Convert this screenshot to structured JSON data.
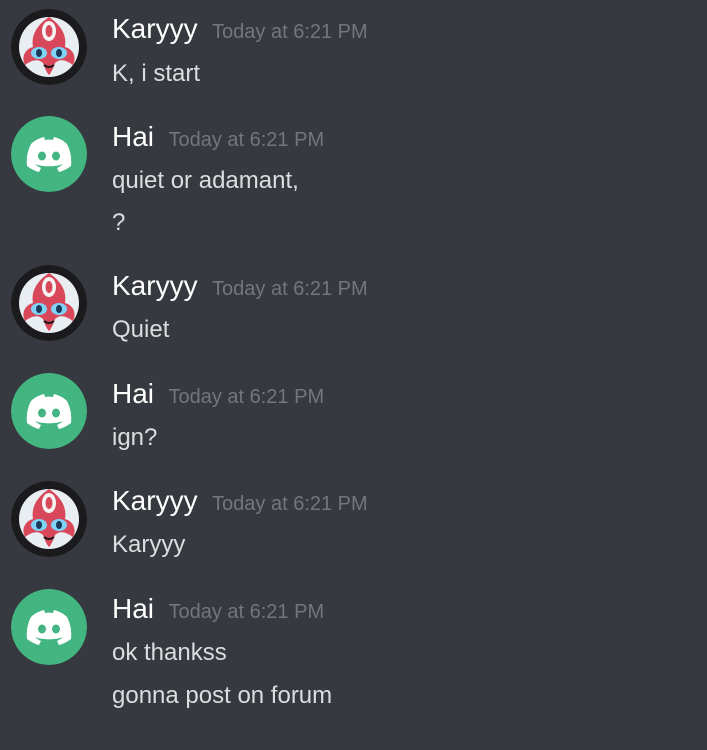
{
  "colors": {
    "background": "#36393f",
    "username": "#ffffff",
    "timestamp": "#72767d",
    "message_text": "#dcddde",
    "discord_avatar_bg": "#43b581"
  },
  "messages": [
    {
      "author": "Karyyy",
      "avatar": "pokemon-avatar-icon",
      "timestamp": "Today at 6:21 PM",
      "lines": [
        "K, i start"
      ]
    },
    {
      "author": "Hai",
      "avatar": "discord-default-avatar-icon",
      "timestamp": "Today at 6:21 PM",
      "lines": [
        "quiet or adamant,",
        "?"
      ]
    },
    {
      "author": "Karyyy",
      "avatar": "pokemon-avatar-icon",
      "timestamp": "Today at 6:21 PM",
      "lines": [
        "Quiet"
      ]
    },
    {
      "author": "Hai",
      "avatar": "discord-default-avatar-icon",
      "timestamp": "Today at 6:21 PM",
      "lines": [
        "ign?"
      ]
    },
    {
      "author": "Karyyy",
      "avatar": "pokemon-avatar-icon",
      "timestamp": "Today at 6:21 PM",
      "lines": [
        "Karyyy"
      ]
    },
    {
      "author": "Hai",
      "avatar": "discord-default-avatar-icon",
      "timestamp": "Today at 6:21 PM",
      "lines": [
        "ok thankss",
        "gonna post on forum"
      ]
    }
  ]
}
